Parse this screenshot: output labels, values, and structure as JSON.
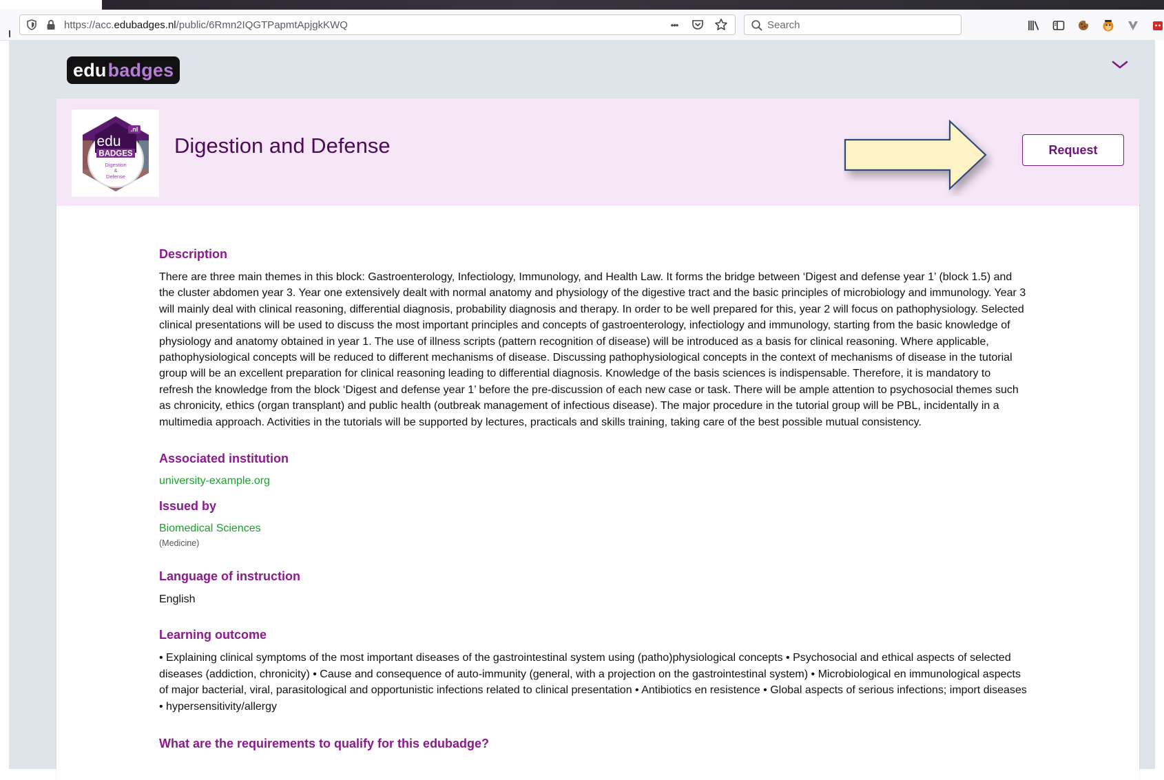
{
  "browser": {
    "url_prefix": "https://acc.",
    "url_domain": "edubadges.nl",
    "url_path": "/public/6Rmn2IQGTPapmtApjgkKWQ",
    "search_placeholder": "Search",
    "more_glyph": "•••"
  },
  "site": {
    "logo_part1": "edu",
    "logo_part2": "badges"
  },
  "badge": {
    "title": "Digestion and Defense",
    "image_lines": [
      "edu",
      "BADGES",
      "Digestion",
      "&",
      "Defense"
    ],
    "image_tag": ".nl",
    "request_label": "Request"
  },
  "sections": {
    "description_heading": "Description",
    "description_text": "There are three main themes in this block: Gastroenterology, Infectiology, Immunology, and Health Law. It forms the bridge between ‘Digest and defense year 1’ (block 1.5) and the cluster abdomen year 3. Year one extensively dealt with normal anatomy and physiology of the digestive tract and the basic principles of microbiology and immunology. Year 3 will mainly deal with clinical reasoning, differential diagnosis, probability diagnosis and therapy. In order to be well prepared for this, year 2 will focus on pathophysiology. Selected clinical presentations will be used to discuss the most important principles and concepts of gastroenterology, infectiology and immunology, starting from the basic knowledge of physiology and anatomy obtained in year 1. The use of illness scripts (pattern recognition of disease) will be introduced as a basis for clinical reasoning. Where applicable, pathophysiological concepts will be reduced to different mechanisms of disease. Discussing pathophysiological concepts in the context of mechanisms of disease in the tutorial group will be an excellent preparation for clinical reasoning leading to differential diagnosis. Knowledge of the basis sciences is indispensable. Therefore, it is mandatory to refresh the knowledge from the block ‘Digest and defense year 1’ before the pre-discussion of each new case or task. There will be ample attention to psychosocial themes such as chronicity, ethics (organ transplant) and public health (outbreak management of infectious disease). The major procedure in the tutorial group will be PBL, incidentally in a multimedia approach. Activities in the tutorials will be supported by lectures, practicals and skills training, taking care of the best possible mutual consistency.",
    "institution_heading": "Associated institution",
    "institution_link": "university-example.org",
    "issued_heading": "Issued by",
    "issuer_link": "Biomedical Sciences",
    "issuer_faculty": "(Medicine)",
    "language_heading": "Language of instruction",
    "language_value": "English",
    "outcome_heading": "Learning outcome",
    "outcome_text": "• Explaining clinical symptoms of the most important diseases of the gastrointestinal system using (patho)physiological concepts • Psychosocial and ethical aspects of selected diseases (addiction, chronicity) • Cause and consequence of auto-immunity (general, with a projection on the gastrointestinal system) • Microbiological en immunological aspects of major bacterial, viral, parasitological and opportunistic infections related to clinical presentation • Antibiotics en resistence • Global aspects of serious infections; import diseases • hypersensitivity/allergy",
    "requirements_heading": "What are the requirements to qualify for this edubadge?"
  },
  "colors": {
    "heading_purple": "#8a1a8e",
    "link_green": "#1aa12c",
    "header_bg": "#f6e6f7",
    "arrow_fill": "#fdf3c4",
    "arrow_stroke": "#2d4a7a"
  }
}
